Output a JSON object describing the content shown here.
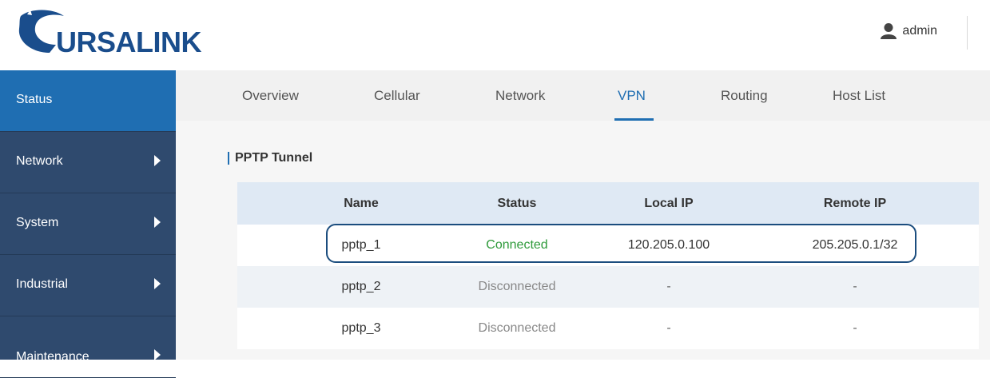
{
  "header": {
    "logo_text": "URSALINK",
    "user_label": "admin"
  },
  "sidebar": {
    "items": [
      {
        "label": "Status",
        "active": true
      },
      {
        "label": "Network"
      },
      {
        "label": "System"
      },
      {
        "label": "Industrial"
      },
      {
        "label": "Maintenance"
      }
    ]
  },
  "tabs": [
    {
      "label": "Overview"
    },
    {
      "label": "Cellular"
    },
    {
      "label": "Network"
    },
    {
      "label": "VPN",
      "active": true
    },
    {
      "label": "Routing"
    },
    {
      "label": "Host List"
    }
  ],
  "section": {
    "title": "PPTP Tunnel"
  },
  "table": {
    "headers": [
      "Name",
      "Status",
      "Local IP",
      "Remote IP"
    ],
    "rows": [
      {
        "name": "pptp_1",
        "status": "Connected",
        "local_ip": "120.205.0.100",
        "remote_ip": "205.205.0.1/32"
      },
      {
        "name": "pptp_2",
        "status": "Disconnected",
        "local_ip": "-",
        "remote_ip": "-"
      },
      {
        "name": "pptp_3",
        "status": "Disconnected",
        "local_ip": "-",
        "remote_ip": "-"
      }
    ]
  },
  "colors": {
    "sidebar_bg": "#2f4a6e",
    "sidebar_active": "#1f6eb2",
    "accent": "#1f6eb2",
    "connected": "#2e9a3a",
    "disconnected": "#888888"
  }
}
